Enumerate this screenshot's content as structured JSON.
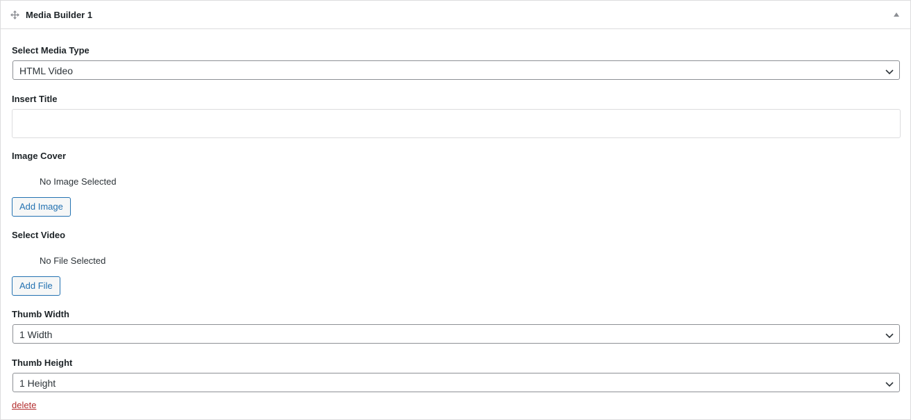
{
  "header": {
    "title": "Media Builder 1",
    "move_icon": "move-arrows-icon",
    "toggle_icon": "caret-up-icon"
  },
  "form": {
    "media_type": {
      "label": "Select Media Type",
      "value": "HTML Video"
    },
    "title": {
      "label": "Insert Title",
      "value": ""
    },
    "image_cover": {
      "label": "Image Cover",
      "status": "No Image Selected",
      "button_label": "Add Image"
    },
    "video": {
      "label": "Select Video",
      "status": "No File Selected",
      "button_label": "Add File"
    },
    "thumb_width": {
      "label": "Thumb Width",
      "value": "1 Width"
    },
    "thumb_height": {
      "label": "Thumb Height",
      "value": "1 Height"
    }
  },
  "actions": {
    "delete_label": "delete"
  },
  "colors": {
    "accent": "#2271b1",
    "delete": "#b32d2e",
    "border": "#dcdcde"
  }
}
